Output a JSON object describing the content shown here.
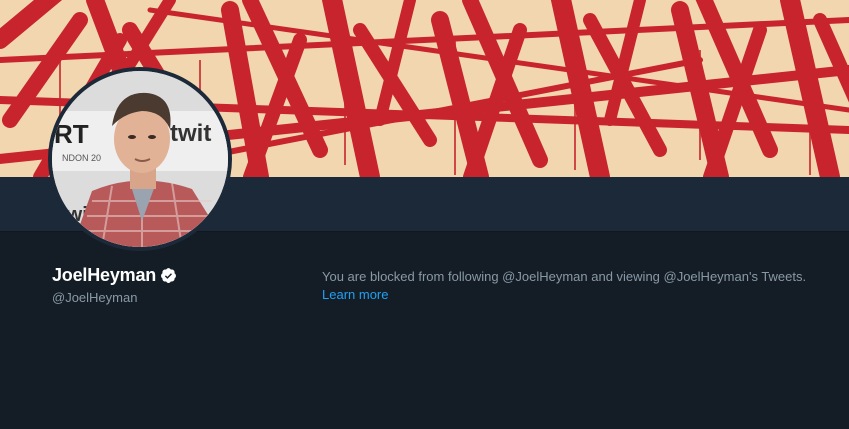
{
  "profile": {
    "display_name": "JoelHeyman",
    "handle": "@JoelHeyman",
    "verified_icon": "verified-badge-icon",
    "avatar_text_left": "RT",
    "avatar_text_right": "twit",
    "avatar_text_sub": "NDON 20",
    "avatar_text_bottom": "twit"
  },
  "blocked_notice": {
    "message": "You are blocked from following @JoelHeyman and viewing @JoelHeyman's Tweets.",
    "link_label": "Learn more"
  },
  "colors": {
    "background": "#141d26",
    "navbar": "#1c2938",
    "banner_base": "#f1d6b0",
    "banner_strokes": "#c8242d",
    "link": "#1da1f2",
    "muted_text": "#8899a6"
  }
}
